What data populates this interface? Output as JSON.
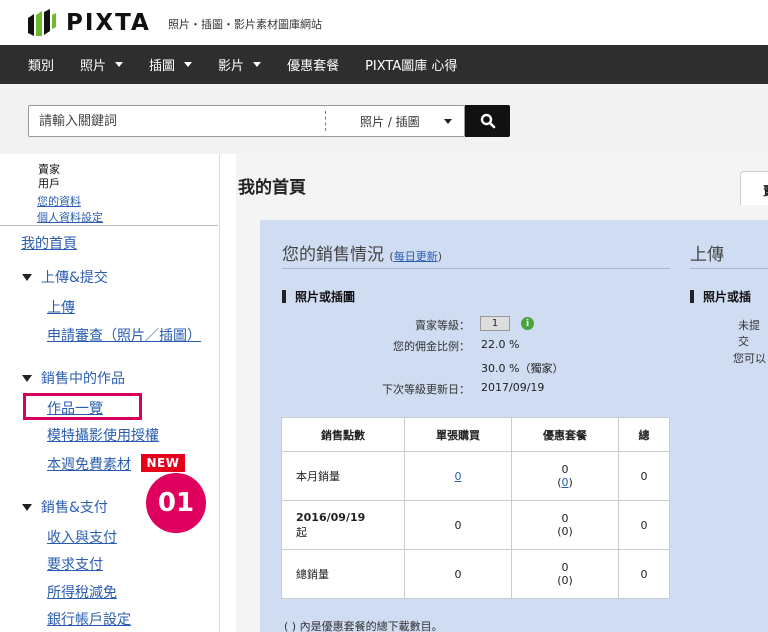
{
  "header": {
    "logo_text": "PIXTA",
    "tagline": "照片・插圖・影片素材圖庫網站"
  },
  "nav": {
    "items": [
      {
        "label": "類別",
        "dropdown": false
      },
      {
        "label": "照片",
        "dropdown": true
      },
      {
        "label": "插圖",
        "dropdown": true
      },
      {
        "label": "影片",
        "dropdown": true
      },
      {
        "label": "優惠套餐",
        "dropdown": false
      },
      {
        "label": "PIXTA圖庫 心得",
        "dropdown": false
      }
    ]
  },
  "search": {
    "placeholder": "請輸入關鍵詞",
    "type_label": "照片 / 插圖"
  },
  "sidebar": {
    "user_type_line1": "賣家",
    "user_type_line2": "用戶",
    "profile_link": "您的資料",
    "settings_link": "個人資料設定",
    "home": "我的首頁",
    "upload_head": "上傳&提交",
    "upload": "上傳",
    "review": "申請審查（照片／插圖）",
    "works_head": "銷售中的作品",
    "works_list": "作品一覽",
    "model_release": "模特攝影使用授權",
    "free_weekly": "本週免費素材",
    "new_badge": "NEW",
    "sales_head": "銷售&支付",
    "income": "收入與支付",
    "request_payment": "要求支付",
    "tax": "所得稅減免",
    "bank": "銀行帳戶設定",
    "step_badge": "01"
  },
  "main": {
    "page_title": "我的首頁",
    "tab_label": "賣",
    "sales_title": "您的銷售情況",
    "daily_update": "每日更新",
    "upload_title": "上傳",
    "section_title": "照片或插圖",
    "section_title_right": "照片或插",
    "seller_level_label": "賣家等級：",
    "seller_level": "1",
    "commission_label": "您的佣金比例：",
    "commission": "22.0 %",
    "commission_exclusive": "30.0 %（獨家）",
    "next_update_label": "下次等級更新日：",
    "next_update": "2017/09/19",
    "right_text1": "未提交",
    "right_text2": "您可以",
    "table": {
      "headers": [
        "銷售點數",
        "單張購買",
        "優惠套餐",
        "總"
      ],
      "rows": [
        {
          "label": "本月銷量",
          "sub": "",
          "single": "0",
          "package": "0",
          "package_paren": "(0)",
          "total": "0"
        },
        {
          "label": "2016/09/19",
          "sub": "起",
          "single": "0",
          "package": "0",
          "package_paren": "(0)",
          "total": "0"
        },
        {
          "label": "總銷量",
          "sub": "",
          "single": "0",
          "package": "0",
          "package_paren": "(0)",
          "total": "0"
        }
      ]
    },
    "footnote": "( ) 內是優惠套餐的總下載數目。"
  }
}
